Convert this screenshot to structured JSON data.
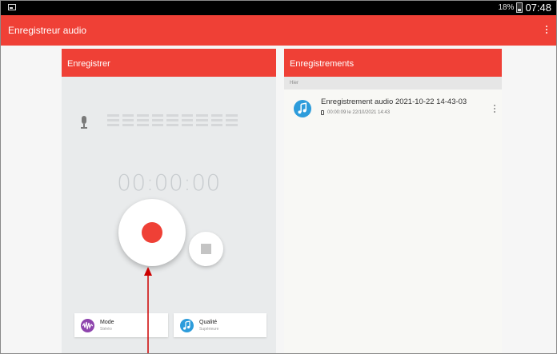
{
  "status_bar": {
    "battery_percent": "18%",
    "clock": "07:48"
  },
  "app_bar": {
    "title": "Enregistreur audio",
    "menu_icon": "overflow-menu-icon"
  },
  "record_panel": {
    "header": "Enregistrer",
    "timer": "00:00:00",
    "mic_icon": "microphone-icon",
    "record_button_icon": "record-icon",
    "stop_button_icon": "stop-icon",
    "options": [
      {
        "label": "Mode",
        "value": "Stéréo",
        "icon": "waveform-icon",
        "color": "#8e44ad"
      },
      {
        "label": "Qualité",
        "value": "Supérieure",
        "icon": "music-note-icon",
        "color": "#2d9cdb"
      }
    ]
  },
  "recordings_panel": {
    "header": "Enregistrements",
    "section": "Hier",
    "items": [
      {
        "title": "Enregistrement audio 2021-10-22 14-43-03",
        "meta": "00:00:09 le 22/10/2021 14:43",
        "icon": "music-note-icon"
      }
    ]
  },
  "colors": {
    "accent": "#ef4036",
    "panel_bg": "#e9ebec",
    "annotation_arrow": "#cc0000"
  }
}
